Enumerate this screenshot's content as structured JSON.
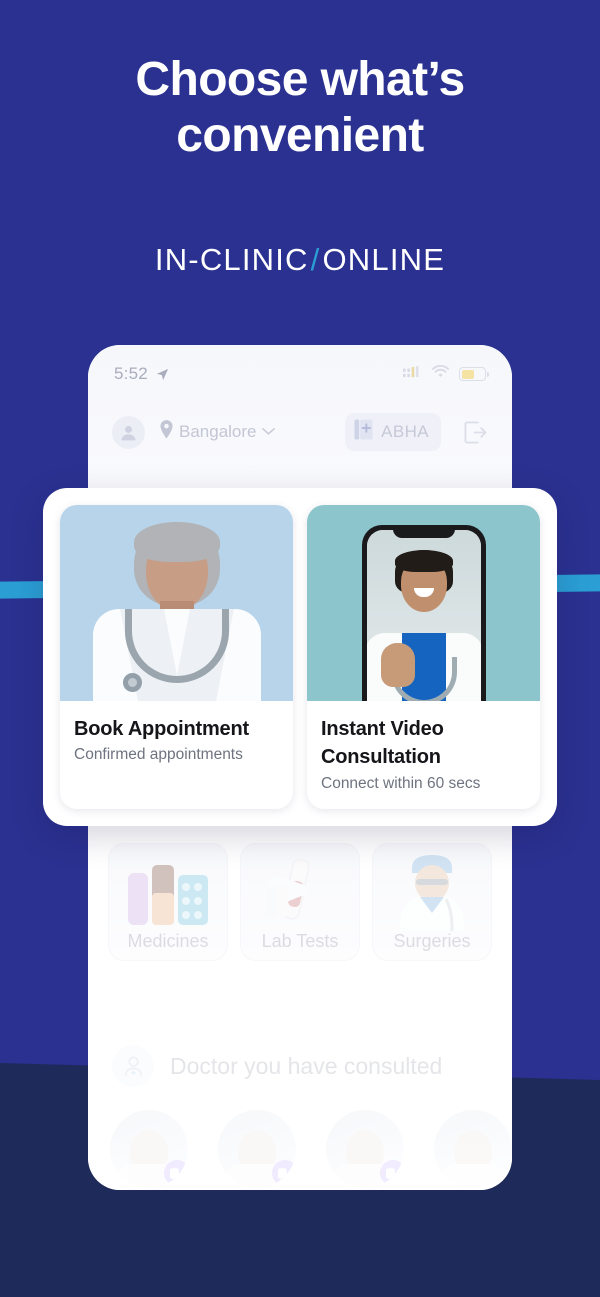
{
  "hero": {
    "headline_line1": "Choose what’s",
    "headline_line2": "convenient",
    "subhead_left": "IN-CLINIC",
    "subhead_separator": "/",
    "subhead_right": "ONLINE",
    "background_color": "#2a3190",
    "band_color": "#1e2a5a",
    "accent_color": "#2b9fd4"
  },
  "phone": {
    "status_bar": {
      "time": "5:52",
      "location_icon": "location-arrow-icon",
      "signal_icon": "signal-bars-icon",
      "wifi_icon": "wifi-icon",
      "battery_icon": "battery-low-power-icon",
      "battery_color": "#f4e3a2"
    },
    "app_bar": {
      "avatar_icon": "user-avatar-icon",
      "location_pin_icon": "location-pin-icon",
      "location_label": "Bangalore",
      "location_chevron_icon": "chevron-down-icon",
      "abha_icon": "abha-card-icon",
      "abha_label": "ABHA",
      "logout_icon": "logout-icon"
    },
    "feature_cards": [
      {
        "title": "Book Appointment",
        "subtitle": "Confirmed appointments",
        "media_name": "doctor-photo-in-clinic",
        "media_bg": "#b7d4ea"
      },
      {
        "title": "Instant Video Consultation",
        "subtitle": "Connect within 60 secs",
        "media_name": "doctor-video-call-photo",
        "media_bg": "#8cc5cb"
      }
    ],
    "service_tiles": [
      {
        "label": "Medicines",
        "icon": "medicines-icon"
      },
      {
        "label": "Lab Tests",
        "icon": "lab-test-tube-icon"
      },
      {
        "label": "Surgeries",
        "icon": "surgeon-icon"
      }
    ],
    "consulted_section": {
      "icon": "consulted-doctor-icon",
      "title": "Doctor you have consulted",
      "doctors": [
        {
          "name": "doctor-avatar-1",
          "badge_icon": "video-call-badge-icon"
        },
        {
          "name": "doctor-avatar-2",
          "badge_icon": "video-call-badge-icon"
        },
        {
          "name": "doctor-avatar-3",
          "badge_icon": "video-call-badge-icon"
        },
        {
          "name": "doctor-avatar-4",
          "badge_icon": "video-call-badge-icon"
        }
      ],
      "badge_color": "#a78bfa"
    }
  }
}
